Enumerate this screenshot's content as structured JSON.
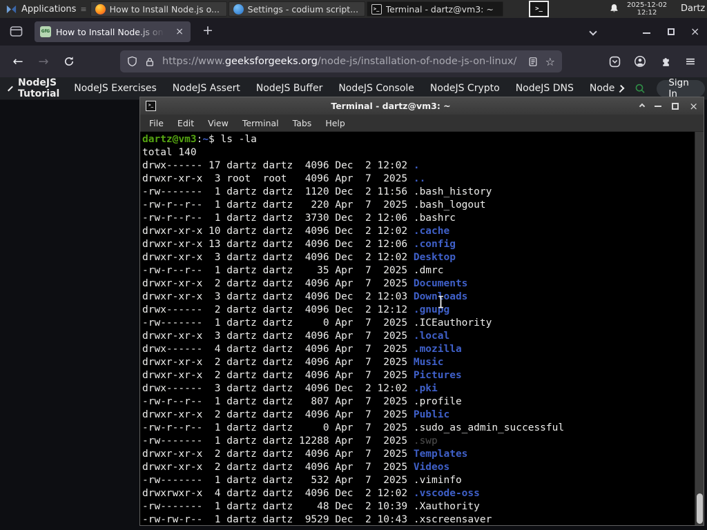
{
  "panel": {
    "applications_label": "Applications",
    "windows": [
      {
        "icon": "firefox",
        "title": "How to Install Node.js o...",
        "active": false
      },
      {
        "icon": "codium",
        "title": "Settings - codium script...",
        "active": false
      },
      {
        "icon": "terminal",
        "title": "Terminal - dartz@vm3: ~",
        "active": true
      }
    ],
    "clock_date": "2025-12-02",
    "clock_time": "12:12",
    "user": "Dartz"
  },
  "browser": {
    "tab_title": "How to Install Node.js on",
    "favicon_text": "GfG",
    "url": {
      "prefix": "https://www.",
      "domain": "geeksforgeeks.org",
      "path": "/node-js/installation-of-node-js-on-linux/"
    },
    "nav": {
      "back_label": "NodeJS Tutorial",
      "items": [
        "NodeJS Exercises",
        "NodeJS Assert",
        "NodeJS Buffer",
        "NodeJS Console",
        "NodeJS Crypto",
        "NodeJS DNS",
        "Node"
      ],
      "sign_in_label": "Sign In"
    }
  },
  "terminal": {
    "title": "Terminal - dartz@vm3: ~",
    "menu": [
      "File",
      "Edit",
      "View",
      "Terminal",
      "Tabs",
      "Help"
    ],
    "prompt": {
      "user": "dartz@vm3",
      "separator": ":",
      "path": "~",
      "command": "$ ls -la"
    },
    "total_line": "total 140",
    "rows": [
      {
        "meta": "drwx------ 17 dartz dartz  4096 Dec  2 12:02 ",
        "name": ".",
        "type": "dir"
      },
      {
        "meta": "drwxr-xr-x  3 root  root   4096 Apr  7  2025 ",
        "name": "..",
        "type": "dir"
      },
      {
        "meta": "-rw-------  1 dartz dartz  1120 Dec  2 11:56 ",
        "name": ".bash_history",
        "type": "file"
      },
      {
        "meta": "-rw-r--r--  1 dartz dartz   220 Apr  7  2025 ",
        "name": ".bash_logout",
        "type": "file"
      },
      {
        "meta": "-rw-r--r--  1 dartz dartz  3730 Dec  2 12:06 ",
        "name": ".bashrc",
        "type": "file"
      },
      {
        "meta": "drwxr-xr-x 10 dartz dartz  4096 Dec  2 12:02 ",
        "name": ".cache",
        "type": "dir"
      },
      {
        "meta": "drwxr-xr-x 13 dartz dartz  4096 Dec  2 12:06 ",
        "name": ".config",
        "type": "dir"
      },
      {
        "meta": "drwxr-xr-x  3 dartz dartz  4096 Dec  2 12:02 ",
        "name": "Desktop",
        "type": "dir"
      },
      {
        "meta": "-rw-r--r--  1 dartz dartz    35 Apr  7  2025 ",
        "name": ".dmrc",
        "type": "file"
      },
      {
        "meta": "drwxr-xr-x  2 dartz dartz  4096 Apr  7  2025 ",
        "name": "Documents",
        "type": "dir"
      },
      {
        "meta": "drwxr-xr-x  3 dartz dartz  4096 Dec  2 12:03 ",
        "name": "Downloads",
        "type": "dir"
      },
      {
        "meta": "drwx------  2 dartz dartz  4096 Dec  2 12:12 ",
        "name": ".gnupg",
        "type": "dir"
      },
      {
        "meta": "-rw-------  1 dartz dartz     0 Apr  7  2025 ",
        "name": ".ICEauthority",
        "type": "file"
      },
      {
        "meta": "drwxr-xr-x  3 dartz dartz  4096 Apr  7  2025 ",
        "name": ".local",
        "type": "dir"
      },
      {
        "meta": "drwx------  4 dartz dartz  4096 Apr  7  2025 ",
        "name": ".mozilla",
        "type": "dir"
      },
      {
        "meta": "drwxr-xr-x  2 dartz dartz  4096 Apr  7  2025 ",
        "name": "Music",
        "type": "dir"
      },
      {
        "meta": "drwxr-xr-x  2 dartz dartz  4096 Apr  7  2025 ",
        "name": "Pictures",
        "type": "dir"
      },
      {
        "meta": "drwx------  3 dartz dartz  4096 Dec  2 12:02 ",
        "name": ".pki",
        "type": "dir"
      },
      {
        "meta": "-rw-r--r--  1 dartz dartz   807 Apr  7  2025 ",
        "name": ".profile",
        "type": "file"
      },
      {
        "meta": "drwxr-xr-x  2 dartz dartz  4096 Apr  7  2025 ",
        "name": "Public",
        "type": "dir"
      },
      {
        "meta": "-rw-r--r--  1 dartz dartz     0 Apr  7  2025 ",
        "name": ".sudo_as_admin_successful",
        "type": "file"
      },
      {
        "meta": "-rw-------  1 dartz dartz 12288 Apr  7  2025 ",
        "name": ".swp",
        "type": "dim"
      },
      {
        "meta": "drwxr-xr-x  2 dartz dartz  4096 Apr  7  2025 ",
        "name": "Templates",
        "type": "dir"
      },
      {
        "meta": "drwxr-xr-x  2 dartz dartz  4096 Apr  7  2025 ",
        "name": "Videos",
        "type": "dir"
      },
      {
        "meta": "-rw-------  1 dartz dartz   532 Apr  7  2025 ",
        "name": ".viminfo",
        "type": "file"
      },
      {
        "meta": "drwxrwxr-x  4 dartz dartz  4096 Dec  2 12:02 ",
        "name": ".vscode-oss",
        "type": "dir"
      },
      {
        "meta": "-rw-------  1 dartz dartz    48 Dec  2 10:39 ",
        "name": ".Xauthority",
        "type": "file"
      },
      {
        "meta": "-rw-rw-r--  1 dartz dartz  9529 Dec  2 10:43 ",
        "name": ".xscreensaver",
        "type": "file"
      }
    ]
  },
  "glyphs": {
    "new_tab": "+",
    "tab_close": "×",
    "window_close": "×",
    "hamburger": "≡",
    "bookmark_star": "☆",
    "grip": "≡",
    "terminal_glyph": ">_"
  },
  "colors": {
    "gfg_green": "#2f8d46",
    "terminal_background": "#000000",
    "terminal_foreground": "#eeeeec",
    "terminal_prompt_green": "#55a511",
    "terminal_dir_blue": "#3f60c9",
    "terminal_dim_file": "#4f4f4f",
    "firefox_tab_active": "#42414d",
    "firefox_toolbar": "#2b2a33",
    "panel_background": "#2b2b2b"
  }
}
